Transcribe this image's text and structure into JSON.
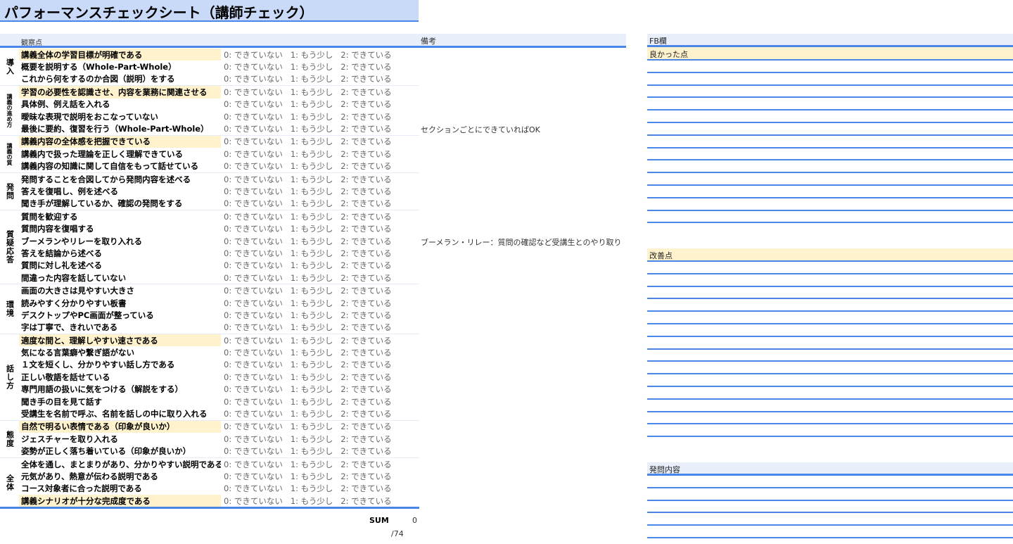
{
  "title": "パフォーマンスチェックシート（講師チェック）",
  "header": {
    "observation": "観察点",
    "remarks": "備考"
  },
  "options": "0: できていない   1: もう少し   2: できている",
  "sections": [
    {
      "label": "導入",
      "small": false,
      "items": [
        {
          "text": "講義全体の学習目標が明確である",
          "hl": true
        },
        {
          "text": "概要を説明する（Whole-Part-Whole）"
        },
        {
          "text": "これから何をするのか合図（説明）をする"
        }
      ]
    },
    {
      "label": "講義の進め方",
      "small": true,
      "items": [
        {
          "text": "学習の必要性を認識させ、内容を業務に関連させる",
          "hl": true
        },
        {
          "text": "具体例、例え話を入れる"
        },
        {
          "text": "曖昧な表現で説明をおこなっていない"
        },
        {
          "text": "最後に要約、復習を行う（Whole-Part-Whole）",
          "remark": "セクションごとにできていればOK"
        }
      ]
    },
    {
      "label": "講義の質",
      "small": true,
      "items": [
        {
          "text": "講義内容の全体感を把握できている",
          "hl": true
        },
        {
          "text": "講義内で扱った理論を正しく理解できている"
        },
        {
          "text": "講義内容の知識に関して自信をもって話せている"
        }
      ]
    },
    {
      "label": "発問",
      "small": false,
      "items": [
        {
          "text": "発問することを合図してから発問内容を述べる"
        },
        {
          "text": "答えを復唱し、例を述べる"
        },
        {
          "text": "聞き手が理解しているか、確認の発問をする"
        }
      ]
    },
    {
      "label": "質疑応答",
      "small": false,
      "items": [
        {
          "text": "質問を歓迎する"
        },
        {
          "text": "質問内容を復唱する"
        },
        {
          "text": "ブーメランやリレーを取り入れる",
          "remark": "ブーメラン・リレー：質問の確認など受講生とのやり取り"
        },
        {
          "text": "答えを結論から述べる"
        },
        {
          "text": "質問に対し礼を述べる"
        },
        {
          "text": "間違った内容を話していない"
        }
      ]
    },
    {
      "label": "環境",
      "small": false,
      "items": [
        {
          "text": "画面の大きさは見やすい大きさ"
        },
        {
          "text": "読みやすく分かりやすい板書"
        },
        {
          "text": "デスクトップやPC画面が整っている"
        },
        {
          "text": "字は丁寧で、きれいである"
        }
      ]
    },
    {
      "label": "話し方",
      "small": false,
      "items": [
        {
          "text": "適度な間と、理解しやすい速さである",
          "hl": true
        },
        {
          "text": "気になる言葉癖や繋ぎ語がない"
        },
        {
          "text": "１文を短くし、分かりやすい話し方である"
        },
        {
          "text": "正しい敬語を話せている"
        },
        {
          "text": "専門用語の扱いに気をつける（解説をする）"
        },
        {
          "text": "聞き手の目を見て話す"
        },
        {
          "text": "受講生を名前で呼ぶ、名前を話しの中に取り入れる"
        }
      ]
    },
    {
      "label": "態度",
      "small": false,
      "items": [
        {
          "text": "自然で明るい表情である（印象が良いか）",
          "hl": true
        },
        {
          "text": "ジェスチャーを取り入れる"
        },
        {
          "text": "姿勢が正しく落ち着いている（印象が良いか）"
        }
      ]
    },
    {
      "label": "全体",
      "small": false,
      "items": [
        {
          "text": "全体を通し、まとまりがあり、分かりやすい説明である"
        },
        {
          "text": "元気があり、熱意が伝わる説明である"
        },
        {
          "text": "コース対象者に合った説明である"
        },
        {
          "text": "講義シナリオが十分な完成度である",
          "hl": true
        }
      ]
    }
  ],
  "sum": {
    "label": "SUM",
    "value": "0",
    "max": "/74"
  },
  "fb": {
    "header": "FB欄",
    "good": "良かった点",
    "improve": "改善点",
    "questions": "発問内容"
  }
}
